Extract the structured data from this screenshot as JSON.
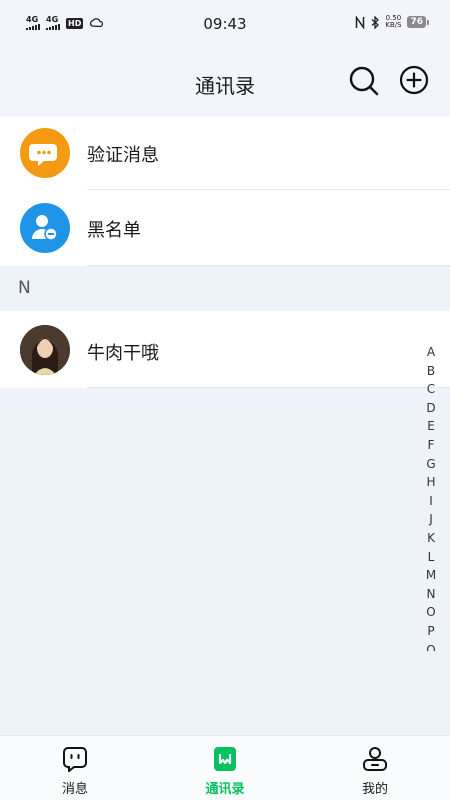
{
  "status_bar": {
    "signal1": "4G",
    "signal2": "4G",
    "hd": "HD",
    "time": "09:43",
    "speed_value": "0.50",
    "speed_unit": "KB/S",
    "battery": "76"
  },
  "header": {
    "title": "通讯录",
    "search_icon": "search-icon",
    "add_icon": "plus-circle-icon"
  },
  "items": [
    {
      "label": "验证消息",
      "icon": "chat-bubble-icon",
      "color": "#f39a12"
    },
    {
      "label": "黑名单",
      "icon": "user-minus-icon",
      "color": "#1e95e6"
    }
  ],
  "section": {
    "letter": "N"
  },
  "contacts": [
    {
      "name": "牛肉干哦",
      "avatar": "avatar-photo"
    }
  ],
  "index_letters": [
    "A",
    "B",
    "C",
    "D",
    "E",
    "F",
    "G",
    "H",
    "I",
    "J",
    "K",
    "L",
    "M",
    "N",
    "O",
    "P",
    "Q"
  ],
  "bottom_nav": {
    "messages_label": "消息",
    "contacts_label": "通讯录",
    "mine_label": "我的",
    "active_color": "#07c160"
  }
}
